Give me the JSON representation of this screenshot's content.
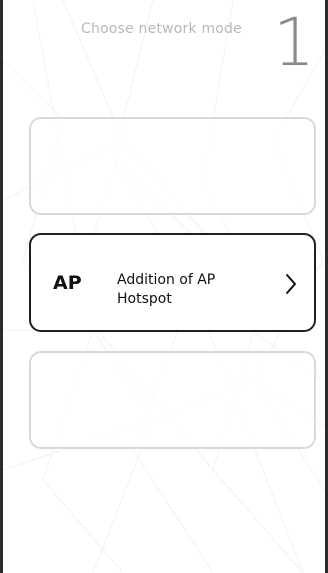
{
  "header": {
    "title": "Choose network mode",
    "step": "1"
  },
  "options": [
    {
      "code": "",
      "label": ""
    },
    {
      "code": "AP",
      "label": "Addition of AP Hotspot",
      "icon": "chevron-right-icon"
    },
    {
      "code": "",
      "label": ""
    }
  ],
  "colors": {
    "border_dark": "#1f1f1f",
    "border_light": "#d9d9d9",
    "title_gray": "#b8b8b8",
    "step_gray": "#8a8a8a"
  }
}
